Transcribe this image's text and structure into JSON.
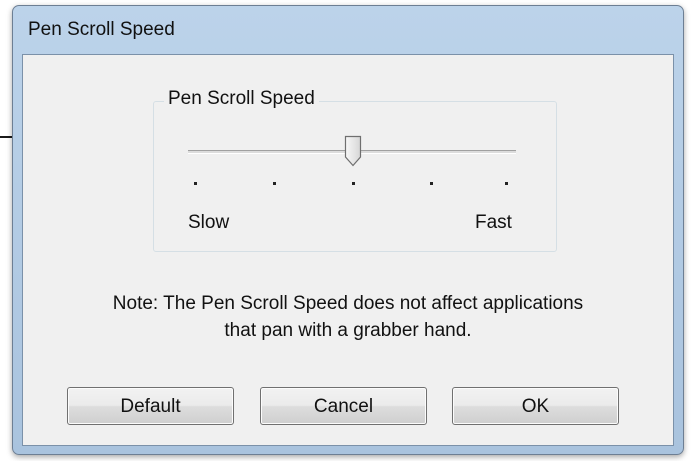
{
  "window": {
    "title": "Pen Scroll Speed"
  },
  "group": {
    "title": "Pen Scroll Speed",
    "slider": {
      "min_label": "Slow",
      "max_label": "Fast",
      "tick_count": 5,
      "value_fraction": 0.5
    }
  },
  "note": {
    "line1": "Note: The Pen Scroll Speed does not affect applications",
    "line2": "that pan with a grabber hand."
  },
  "buttons": {
    "default": "Default",
    "cancel": "Cancel",
    "ok": "OK"
  }
}
